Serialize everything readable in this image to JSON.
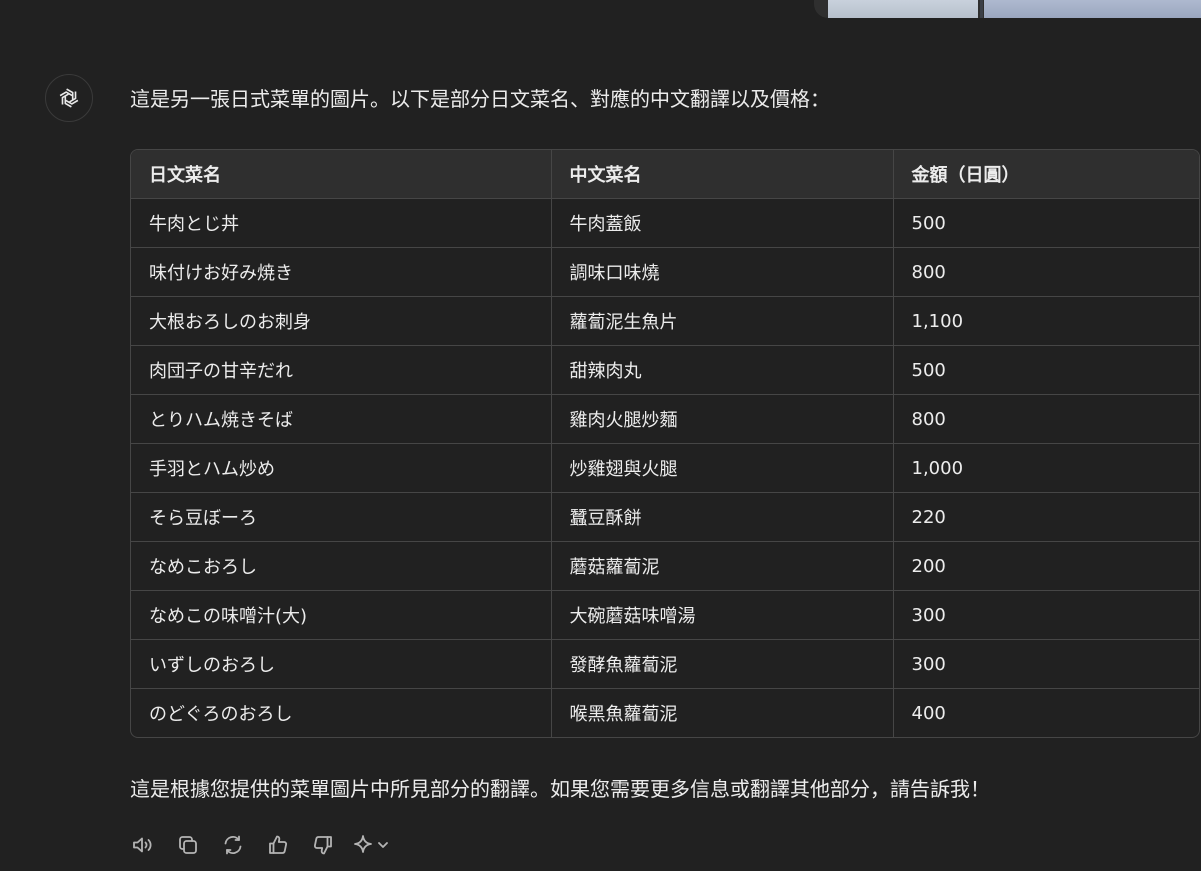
{
  "message": {
    "intro": "這是另一張日式菜單的圖片。以下是部分日文菜名、對應的中文翻譯以及價格：",
    "outro": "這是根據您提供的菜單圖片中所見部分的翻譯。如果您需要更多信息或翻譯其他部分，請告訴我！"
  },
  "table": {
    "headers": [
      "日文菜名",
      "中文菜名",
      "金額（日圓）"
    ],
    "rows": [
      [
        "牛肉とじ丼",
        "牛肉蓋飯",
        "500"
      ],
      [
        "味付けお好み焼き",
        "調味口味燒",
        "800"
      ],
      [
        "大根おろしのお刺身",
        "蘿蔔泥生魚片",
        "1,100"
      ],
      [
        "肉団子の甘辛だれ",
        "甜辣肉丸",
        "500"
      ],
      [
        "とりハム焼きそば",
        "雞肉火腿炒麵",
        "800"
      ],
      [
        "手羽とハム炒め",
        "炒雞翅與火腿",
        "1,000"
      ],
      [
        "そら豆ぼーろ",
        "蠶豆酥餅",
        "220"
      ],
      [
        "なめこおろし",
        "蘑菇蘿蔔泥",
        "200"
      ],
      [
        "なめこの味噌汁(大)",
        "大碗蘑菇味噌湯",
        "300"
      ],
      [
        "いずしのおろし",
        "發酵魚蘿蔔泥",
        "300"
      ],
      [
        "のどぐろのおろし",
        "喉黑魚蘿蔔泥",
        "400"
      ]
    ]
  },
  "icons": {
    "avatar": "openai-logo-icon",
    "actions": [
      "read-aloud-icon",
      "copy-icon",
      "regenerate-icon",
      "thumbs-up-icon",
      "thumbs-down-icon",
      "sparkle-model-icon",
      "chevron-down-icon"
    ]
  },
  "colors": {
    "background": "#212121",
    "text": "#ececec",
    "header_bg": "#2f2f2f",
    "border": "#464646",
    "icon": "#b4b4b4"
  }
}
